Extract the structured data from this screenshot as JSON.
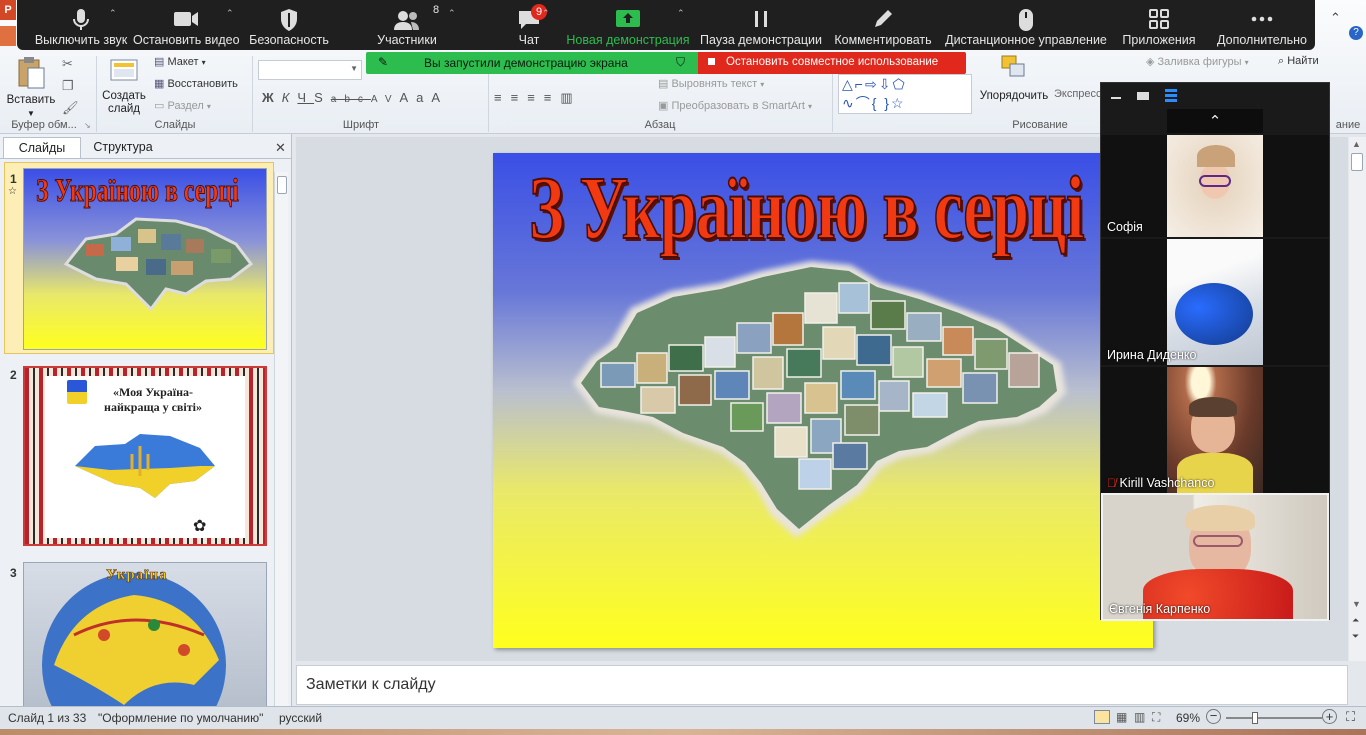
{
  "zoom_toolbar": {
    "items": [
      {
        "label": "Выключить звук",
        "icon": "microphone-icon"
      },
      {
        "label": "Остановить видео",
        "icon": "video-camera-icon"
      },
      {
        "label": "Безопасность",
        "icon": "shield-icon"
      },
      {
        "label": "Участники",
        "icon": "participants-icon",
        "badge": "8"
      },
      {
        "label": "Чат",
        "icon": "chat-icon",
        "badge": "9"
      },
      {
        "label": "Новая демонстрация",
        "icon": "share-screen-icon"
      },
      {
        "label": "Пауза демонстрации",
        "icon": "pause-icon"
      },
      {
        "label": "Комментировать",
        "icon": "pen-icon"
      },
      {
        "label": "Дистанционное управление",
        "icon": "mouse-icon"
      },
      {
        "label": "Приложения",
        "icon": "apps-icon"
      },
      {
        "label": "Дополнительно",
        "icon": "more-icon"
      }
    ],
    "accent_green": "#2dbd4f"
  },
  "share_bar": {
    "status": "Вы запустили демонстрацию экрана",
    "stop": "Остановить совместное использование"
  },
  "ribbon": {
    "paste": "Вставить",
    "clipboard_group": "Буфер обм...",
    "new_slide": "Создать слайд",
    "layout": "Макет",
    "reset": "Восстановить",
    "section": "Раздел",
    "slides_group": "Слайды",
    "font_group": "Шрифт",
    "paragraph_group": "Абзац",
    "align_text": "Выровнять текст",
    "smartart": "Преобразовать в SmartArt",
    "arrange": "Упорядочить",
    "quick_styles": "Экспресс",
    "drawing_group": "Рисование",
    "shape_fill": "Заливка фигуры",
    "find": "Найти",
    "edit_group_partial": "ание"
  },
  "left_panel": {
    "tab_slides": "Слайды",
    "tab_outline": "Структура",
    "slide_numbers": [
      "1",
      "2",
      "3"
    ],
    "thumb1_title": "З Україною в серці",
    "thumb2_title": "«Моя Україна-найкраща у світі»",
    "thumb3_label": "Україна"
  },
  "slide": {
    "title": "З Україною в серці",
    "gradient_top": "#3a4fe6",
    "gradient_bottom": "#ffff1e",
    "title_color": "#f23a12"
  },
  "notes_placeholder": "Заметки к слайду",
  "participants": [
    {
      "name": "Софія",
      "muted": false
    },
    {
      "name": "Ирина Диденко",
      "muted": false
    },
    {
      "name": "Kirill Vashchanco",
      "muted": true
    },
    {
      "name": "Євгенія Карпенко",
      "muted": false
    }
  ],
  "status_bar": {
    "slide_info": "Слайд 1 из 33",
    "theme": "\"Оформление по умолчанию\"",
    "language": "русский",
    "zoom": "69%"
  }
}
